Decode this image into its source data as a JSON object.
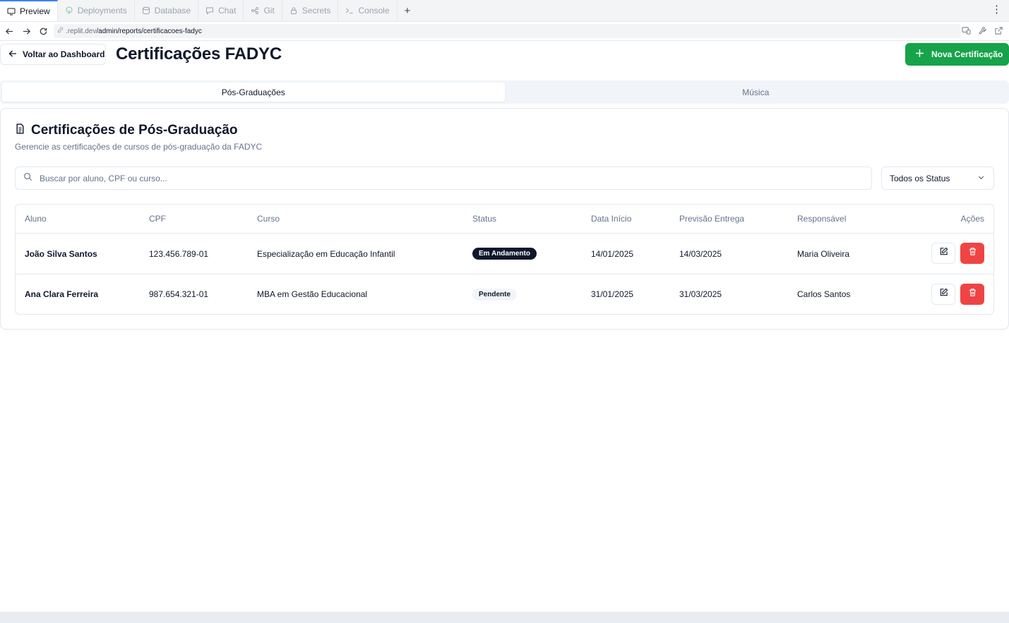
{
  "ide_tabs": [
    {
      "label": "Preview",
      "icon": "monitor-icon",
      "active": true
    },
    {
      "label": "Deployments",
      "icon": "deployments-icon",
      "active": false
    },
    {
      "label": "Database",
      "icon": "database-icon",
      "active": false
    },
    {
      "label": "Chat",
      "icon": "chat-icon",
      "active": false
    },
    {
      "label": "Git",
      "icon": "git-icon",
      "active": false
    },
    {
      "label": "Secrets",
      "icon": "lock-icon",
      "active": false
    },
    {
      "label": "Console",
      "icon": "terminal-icon",
      "active": false
    }
  ],
  "new_tab_symbol": "+",
  "menu_symbol": "⋮",
  "url": {
    "host": ".replit.dev",
    "path": "/admin/reports/certificacoes-fadyc"
  },
  "header": {
    "back_label": "Voltar ao Dashboard",
    "title": "Certificações FADYC",
    "new_label": "Nova Certificação"
  },
  "tabs": [
    {
      "label": "Pós-Graduações",
      "active": true
    },
    {
      "label": "Música",
      "active": false
    }
  ],
  "card": {
    "title": "Certificações de Pós-Graduação",
    "description": "Gerencie as certificações de cursos de pós-graduação da FADYC"
  },
  "search": {
    "placeholder": "Buscar por aluno, CPF ou curso...",
    "value": ""
  },
  "status_filter": {
    "selected": "Todos os Status"
  },
  "table": {
    "columns": [
      "Aluno",
      "CPF",
      "Curso",
      "Status",
      "Data Início",
      "Previsão Entrega",
      "Responsável",
      "Ações"
    ],
    "rows": [
      {
        "aluno": "João Silva Santos",
        "cpf": "123.456.789-01",
        "curso": "Especialização em Educação Infantil",
        "status": "Em Andamento",
        "data_inicio": "14/01/2025",
        "previsao": "14/03/2025",
        "responsavel": "Maria Oliveira"
      },
      {
        "aluno": "Ana Clara Ferreira",
        "cpf": "987.654.321-01",
        "curso": "MBA em Gestão Educacional",
        "status": "Pendente",
        "data_inicio": "31/01/2025",
        "previsao": "31/03/2025",
        "responsavel": "Carlos Santos"
      }
    ]
  },
  "colors": {
    "primary_green": "#16a34a",
    "danger_red": "#ef4444",
    "badge_dark": "#0f172a",
    "badge_light": "#f1f5f9"
  }
}
